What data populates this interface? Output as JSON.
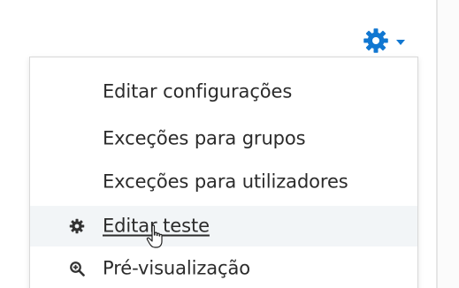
{
  "actions_menu": {
    "toggle_icon": "gear-icon",
    "caret_icon": "caret-down-icon",
    "accent_color": "#1177d1",
    "items": [
      {
        "label": "Editar configurações",
        "icon": null
      },
      {
        "label": "Exceções para grupos",
        "icon": null
      },
      {
        "label": "Exceções para utilizadores",
        "icon": null
      },
      {
        "label": "Editar teste",
        "icon": "gear-icon",
        "state": "hover"
      },
      {
        "label": "Pré-visualização",
        "icon": "zoom-in-icon"
      }
    ]
  },
  "pointer": {
    "icon": "hand-pointer-icon"
  }
}
